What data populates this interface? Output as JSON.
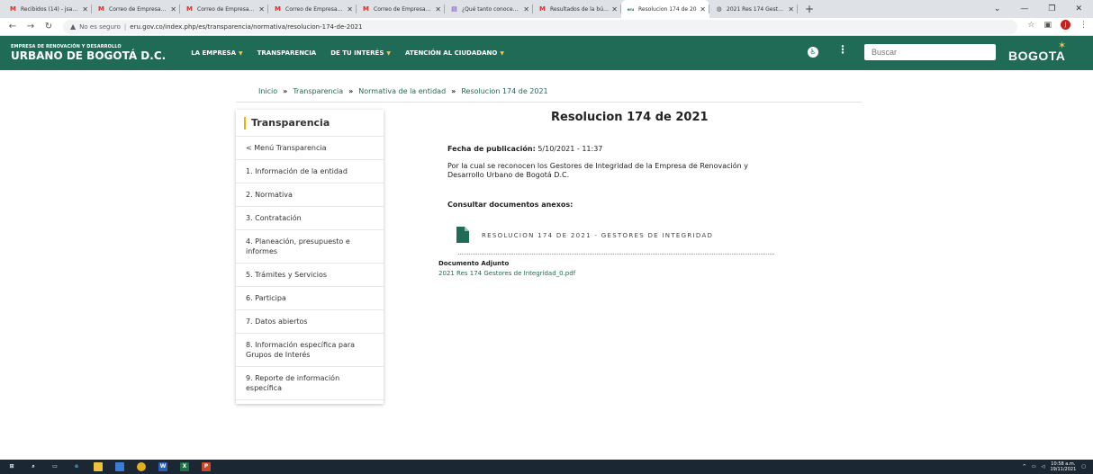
{
  "browser": {
    "tabs": [
      {
        "label": "Recibidos (14) - jsanto",
        "favicon": "M",
        "favicon_color": "#d93025"
      },
      {
        "label": "Correo de Empresa de",
        "favicon": "M",
        "favicon_color": "#d93025"
      },
      {
        "label": "Correo de Empresa de",
        "favicon": "M",
        "favicon_color": "#d93025"
      },
      {
        "label": "Correo de Empresa de",
        "favicon": "M",
        "favicon_color": "#d93025"
      },
      {
        "label": "Correo de Empresa de",
        "favicon": "M",
        "favicon_color": "#d93025"
      },
      {
        "label": "¿Qué tanto conoces d",
        "favicon": "▤",
        "favicon_color": "#673ab7"
      },
      {
        "label": "Resultados de la búsq",
        "favicon": "M",
        "favicon_color": "#d93025"
      },
      {
        "label": "Resolucion 174 de 20",
        "favicon": "eru",
        "favicon_color": "#1f6b56",
        "active": true
      },
      {
        "label": "2021 Res 174 Gestore",
        "favicon": "◍",
        "favicon_color": "#555"
      }
    ],
    "address": {
      "security_label": "No es seguro",
      "url": "eru.gov.co/index.php/es/transparencia/normativa/resolucion-174-de-2021"
    },
    "profile_initial": "J"
  },
  "site": {
    "brand_small": "EMPRESA DE RENOVACIÓN Y DESARROLLO",
    "brand_big": "URBANO DE BOGOTÁ D.C.",
    "nav": [
      {
        "label": "LA EMPRESA",
        "has_caret": true
      },
      {
        "label": "TRANSPARENCIA",
        "has_caret": false
      },
      {
        "label": "DE TU INTERÉS",
        "has_caret": true
      },
      {
        "label": "ATENCIÓN AL CIUDADANO",
        "has_caret": true
      }
    ],
    "search_placeholder": "Buscar",
    "logo_text": "BOGOTA",
    "colors": {
      "primary": "#1f6b56",
      "accent": "#f6c343"
    }
  },
  "breadcrumb": {
    "items": [
      "Inicio",
      "Transparencia",
      "Normativa de la entidad",
      "Resolucion 174 de 2021"
    ],
    "separator": "»"
  },
  "sidebar": {
    "title": "Transparencia",
    "items": [
      "< Menú Transparencia",
      "1. Información de la entidad",
      "2. Normativa",
      "3. Contratación",
      "4. Planeación, presupuesto e informes",
      "5. Trámites y Servicios",
      "6. Participa",
      "7. Datos abiertos",
      "8. Información específica para Grupos de Interés",
      "9. Reporte de información específica"
    ]
  },
  "article": {
    "title": "Resolucion 174 de 2021",
    "pub_label": "Fecha de publicación:",
    "pub_value": "5/10/2021 - 11:37",
    "desc_line1": "Por la cual se reconocen los Gestores de Integridad de la Empresa de Renovación y",
    "desc_line2": "Desarrollo Urbano de Bogotá D.C.",
    "consult_label": "Consultar documentos anexos:",
    "doc_label": "RESOLUCION 174 DE 2021 - GESTORES DE INTEGRIDAD",
    "attach_label": "Documento Adjunto",
    "attach_file": "2021 Res 174 Gestores de Integridad_0.pdf"
  },
  "taskbar": {
    "time": "10:58 a.m.",
    "date": "19/11/2021"
  }
}
